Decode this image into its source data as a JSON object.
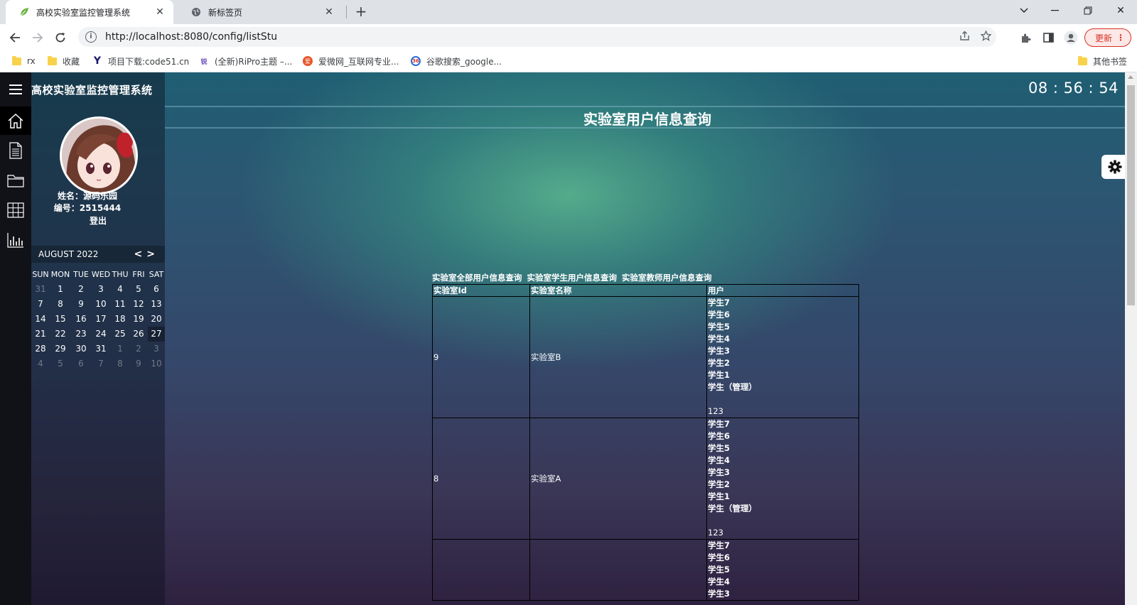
{
  "browser": {
    "tabs": [
      {
        "title": "高校实验室监控管理系统",
        "active": true
      },
      {
        "title": "新标签页",
        "active": false
      }
    ],
    "url_scheme": "http://",
    "url_host": "localhost",
    "url_rest": ":8080/config/listStu",
    "update_label": "更新",
    "bookmarks": [
      "rx",
      "收藏",
      "项目下载:code51.cn",
      "(全新)RiPro主题 –...",
      "爱微网_互联网专业...",
      "谷歌搜索_google..."
    ],
    "other_bookmarks": "其他书签"
  },
  "app": {
    "title": "高校实验室监控管理系统",
    "clock": "08 : 56 : 54",
    "page_title": "实验室用户信息查询"
  },
  "profile": {
    "name_label": "姓名：",
    "name_value": "源码乐园",
    "id_label": "编号：",
    "id_value": "2515444",
    "logout": "登出"
  },
  "calendar": {
    "month_label": "AUGUST 2022",
    "weekdays": [
      "SUN",
      "MON",
      "TUE",
      "WED",
      "THU",
      "FRI",
      "SAT"
    ],
    "weeks": [
      [
        "31",
        "1",
        "2",
        "3",
        "4",
        "5",
        "6"
      ],
      [
        "7",
        "8",
        "9",
        "10",
        "11",
        "12",
        "13"
      ],
      [
        "14",
        "15",
        "16",
        "17",
        "18",
        "19",
        "20"
      ],
      [
        "21",
        "22",
        "23",
        "24",
        "25",
        "26",
        "27"
      ],
      [
        "28",
        "29",
        "30",
        "31",
        "1",
        "2",
        "3"
      ],
      [
        "4",
        "5",
        "6",
        "7",
        "8",
        "9",
        "10"
      ]
    ]
  },
  "query_links": [
    "实验室全部用户信息查询",
    "实验室学生用户信息查询",
    "实验室教师用户信息查询"
  ],
  "table": {
    "headers": [
      "实验室Id",
      "实验室名称",
      "用户"
    ],
    "rows": [
      {
        "id": "9",
        "name": "实验室B",
        "users": [
          "学生7",
          "学生6",
          "学生5",
          "学生4",
          "学生3",
          "学生2",
          "学生1",
          "学生（管理）",
          "",
          "123"
        ]
      },
      {
        "id": "8",
        "name": "实验室A",
        "users": [
          "学生7",
          "学生6",
          "学生5",
          "学生4",
          "学生3",
          "学生2",
          "学生1",
          "学生（管理）",
          "",
          "123"
        ]
      },
      {
        "id": "",
        "name": "",
        "users": [
          "学生7",
          "学生6",
          "学生5",
          "学生4",
          "学生3"
        ]
      }
    ]
  }
}
